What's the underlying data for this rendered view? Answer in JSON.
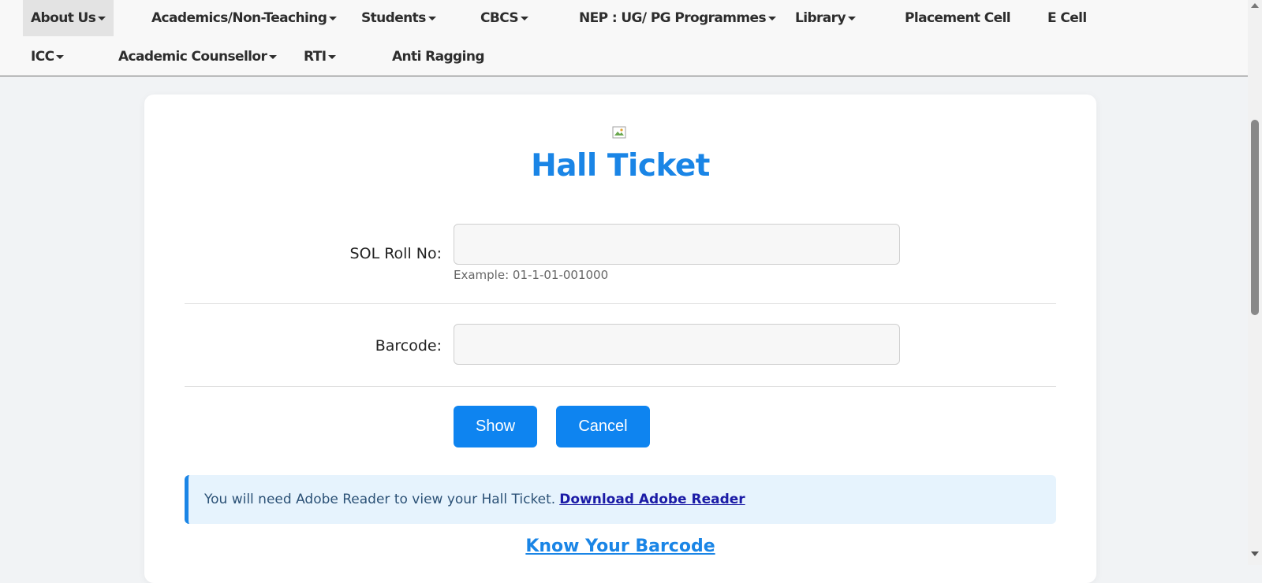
{
  "nav": {
    "items": [
      {
        "label": "About Us",
        "dropdown": true,
        "active": true
      },
      {
        "label": "Academics/Non-Teaching",
        "dropdown": true
      },
      {
        "label": "Students",
        "dropdown": true
      },
      {
        "label": "CBCS",
        "dropdown": true
      },
      {
        "label": "NEP : UG/ PG Programmes",
        "dropdown": true
      },
      {
        "label": "Library",
        "dropdown": true
      },
      {
        "label": "Placement Cell",
        "dropdown": false
      },
      {
        "label": "E Cell",
        "dropdown": false
      },
      {
        "label": "ICC",
        "dropdown": true
      },
      {
        "label": "Academic Counsellor",
        "dropdown": true
      },
      {
        "label": "RTI",
        "dropdown": true
      },
      {
        "label": "Anti Ragging",
        "dropdown": false
      }
    ]
  },
  "form": {
    "title": "Hall Ticket",
    "roll_label": "SOL Roll No:",
    "roll_value": "",
    "roll_help": "Example: 01-1-01-001000",
    "barcode_label": "Barcode:",
    "barcode_value": "",
    "show_label": "Show",
    "cancel_label": "Cancel"
  },
  "notice": {
    "text": "You will need Adobe Reader to view your Hall Ticket.",
    "link_label": "Download Adobe Reader"
  },
  "know_barcode_label": "Know Your Barcode",
  "colors": {
    "accent": "#1a85e6",
    "button": "#0e84f0",
    "notice_bg": "#e6f3fd",
    "link": "#1b1ba6"
  }
}
